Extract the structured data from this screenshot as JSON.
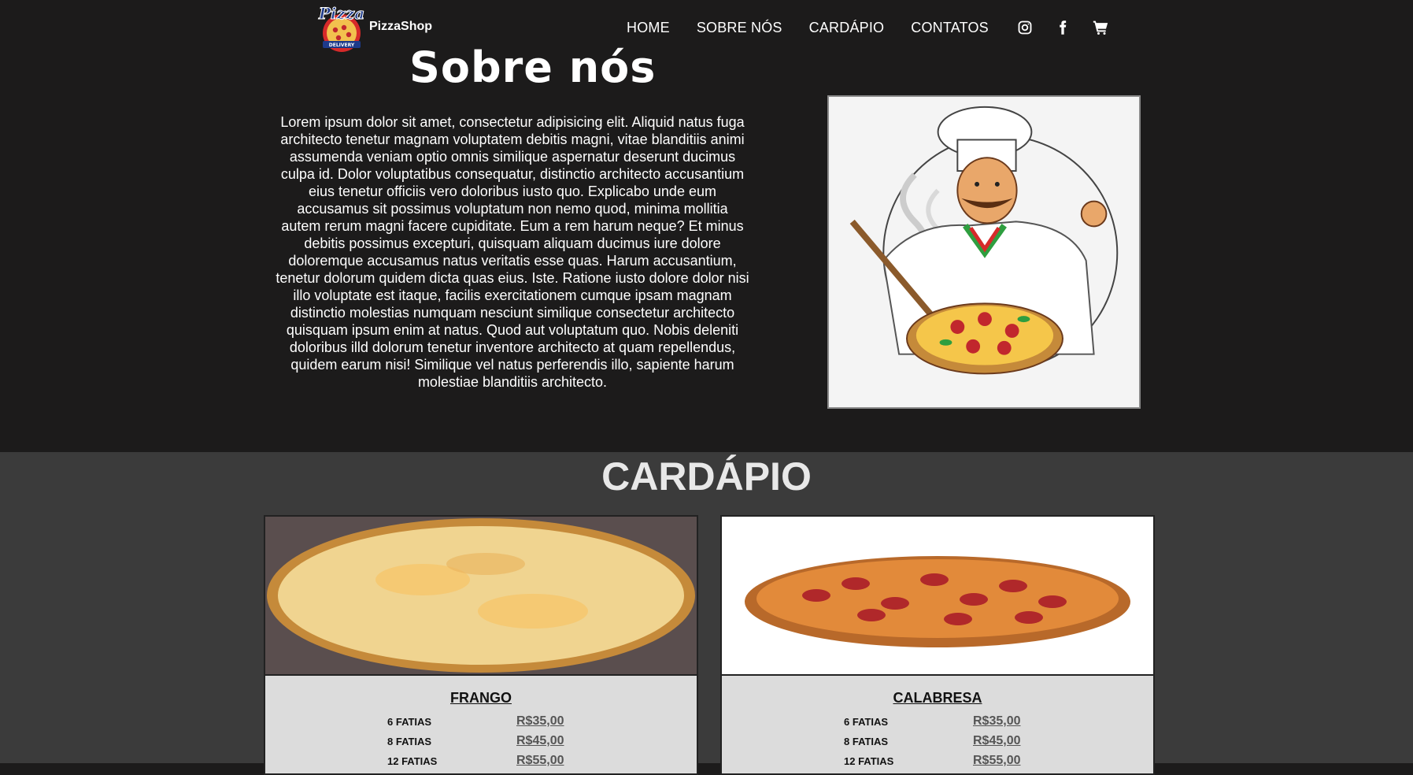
{
  "brand": {
    "name": "PizzaShop",
    "logo_text": "Pizza",
    "logo_subtext": "DELIVERY"
  },
  "nav": {
    "links": [
      "HOME",
      "SOBRE NÓS",
      "CARDÁPIO",
      "CONTATOS"
    ],
    "icons": [
      "instagram-icon",
      "facebook-icon",
      "cart-icon"
    ]
  },
  "about": {
    "title": "Sobre nós",
    "text": "Lorem ipsum dolor sit amet, consectetur adipisicing elit. Aliquid natus fuga architecto tenetur magnam voluptatem debitis magni, vitae blanditiis animi assumenda veniam optio omnis similique aspernatur deserunt ducimus culpa id. Dolor voluptatibus consequatur, distinctio architecto accusantium eius tenetur officiis vero doloribus iusto quo. Explicabo unde eum accusamus sit possimus voluptatum non nemo quod, minima mollitia autem rerum magni facere cupiditate. Eum a rem harum neque? Et minus debitis possimus excepturi, quisquam aliquam ducimus iure dolore doloremque accusamus natus veritatis esse quas. Harum accusantium, tenetur dolorum quidem dicta quas eius. Iste. Ratione iusto dolore dolor nisi illo voluptate est itaque, facilis exercitationem cumque ipsam magnam distinctio molestias numquam nesciunt similique consectetur architecto quisquam ipsum enim at natus. Quod aut voluptatum quo. Nobis deleniti doloribus illd dolorum tenetur inventore architecto at quam repellendus, quidem earum nisi! Similique vel natus perferendis illo, sapiente harum molestiae blanditiis architecto."
  },
  "menu": {
    "title": "CARDÁPIO",
    "items": [
      {
        "name": "FRANGO",
        "prices": [
          {
            "slices": "6 FATIAS",
            "price": "R$35,00"
          },
          {
            "slices": "8 FATIAS",
            "price": "R$45,00"
          },
          {
            "slices": "12 FATIAS",
            "price": "R$55,00"
          }
        ]
      },
      {
        "name": "CALABRESA",
        "prices": [
          {
            "slices": "6 FATIAS",
            "price": "R$35,00"
          },
          {
            "slices": "8 FATIAS",
            "price": "R$45,00"
          },
          {
            "slices": "12 FATIAS",
            "price": "R$55,00"
          }
        ]
      }
    ]
  },
  "colors": {
    "header_bg": "#1c1b1b",
    "menu_bg": "#3b3b3b",
    "card_body_bg": "#dcdcdc",
    "logo_red": "#d62a2a",
    "logo_blue": "#1d3a8a"
  }
}
